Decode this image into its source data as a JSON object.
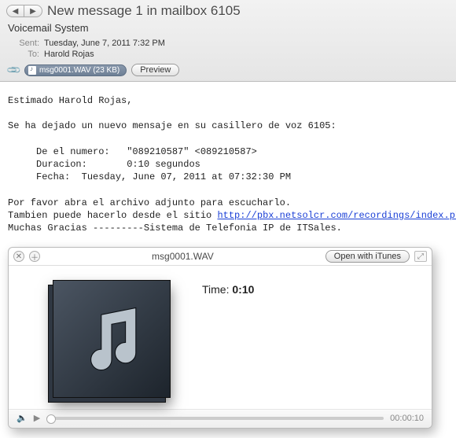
{
  "header": {
    "subject": "New message 1 in mailbox 6105",
    "from": "Voicemail System",
    "sent_label": "Sent:",
    "sent_value": "Tuesday, June 7, 2011 7:32 PM",
    "to_label": "To:",
    "to_value": "Harold Rojas",
    "attachment": {
      "filename": "msg0001.WAV",
      "size": "(23 KB)",
      "chip_text": "msg0001.WAV (23 KB)"
    },
    "preview_button": "Preview"
  },
  "body": {
    "greeting": "Estimado Harold Rojas,",
    "line_intro": "Se ha dejado un nuevo mensaje en su casillero de voz 6105:",
    "detail_from": "     De el numero:   \"089210587\" <089210587>",
    "detail_dur": "     Duracion:       0:10 segundos",
    "detail_date": "     Fecha:  Tuesday, June 07, 2011 at 07:32:30 PM",
    "line_open": "Por favor abra el archivo adjunto para escucharlo.",
    "line_also_pre": "Tambien puede hacerlo desde el sitio ",
    "link_url": "http://pbx.netsolcr.com/recordings/index.php",
    "line_thanks": "Muchas Gracias ---------Sistema de Telefonia IP de ITSales."
  },
  "preview": {
    "filename": "msg0001.WAV",
    "open_button": "Open with iTunes",
    "time_label": "Time: ",
    "time_value": "0:10",
    "elapsed": "00:00:10"
  }
}
